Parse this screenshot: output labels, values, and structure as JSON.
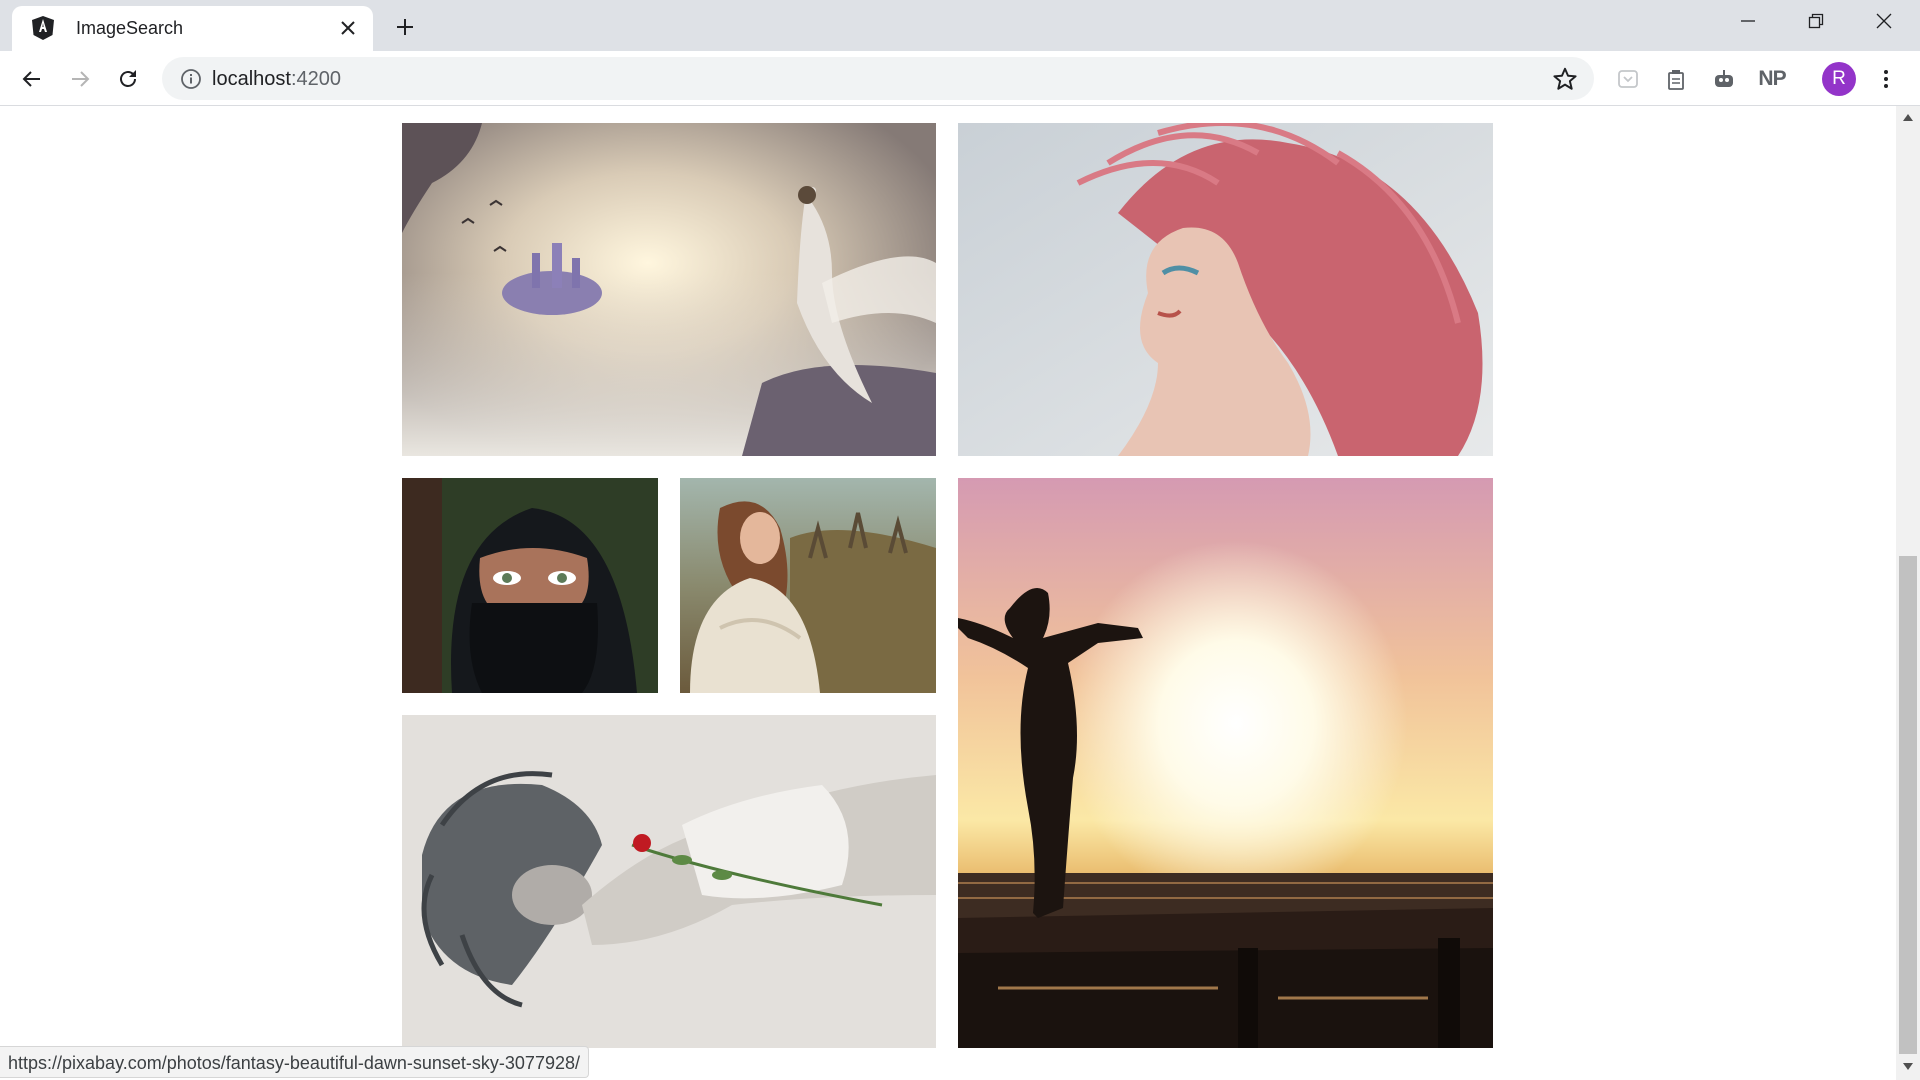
{
  "browser": {
    "tab_title": "ImageSearch",
    "favicon": "angular-icon",
    "url_host": "localhost",
    "url_port": ":4200",
    "profile_initial": "R",
    "profile_color": "#9334c9",
    "extensions": [
      "pocket-icon",
      "clipboard-icon",
      "robot-icon",
      "NP"
    ]
  },
  "gallery": {
    "photos": [
      {
        "name": "photo-fantasy-castle-sky",
        "description": "fantasy woman on cliff looking at floating castle in clouds"
      },
      {
        "name": "photo-pink-hair",
        "description": "woman with flowing pink hair"
      },
      {
        "name": "photo-hijab-eyes",
        "description": "woman in black hijab with green eyes"
      },
      {
        "name": "photo-woman-autumn",
        "description": "woman in knit shawl in autumn field"
      },
      {
        "name": "photo-sunset-silhouette",
        "description": "silhouette of woman on pier at sunset"
      },
      {
        "name": "photo-woman-rose",
        "description": "black and white woman lying with red rose"
      }
    ]
  },
  "status_url": "https://pixabay.com/photos/fantasy-beautiful-dawn-sunset-sky-3077928/"
}
